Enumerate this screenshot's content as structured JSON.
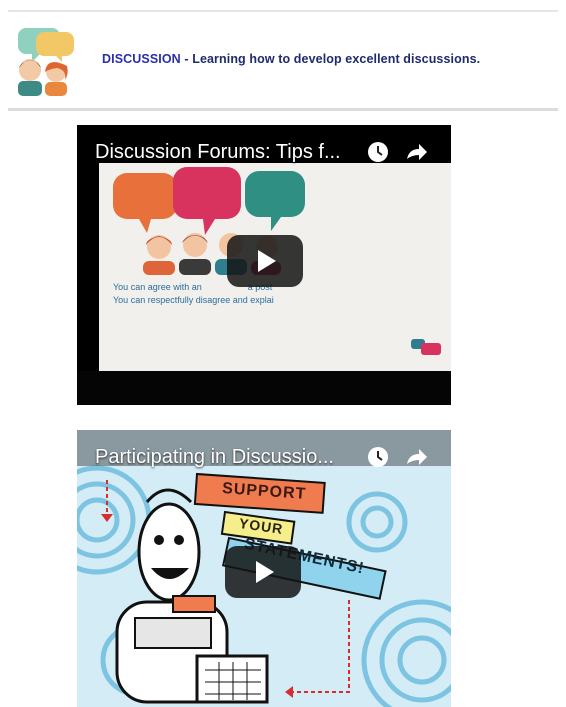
{
  "header": {
    "keyword": "DISCUSSION",
    "rest": " - Learning how to develop excellent discussions."
  },
  "videos": [
    {
      "title": "Discussion Forums: Tips f...",
      "overlay_lines": [
        "You can agree with an",
        "a post",
        "You can respectfully disagree and explai"
      ]
    },
    {
      "title": "Participating in Discussio...",
      "banners": [
        "SUPPORT",
        "YOUR",
        "STATEMENTS!"
      ]
    }
  ],
  "colors": {
    "header_keyword": "#2a2fa8",
    "header_text": "#1f2b6e",
    "bubble_orange": "#e8703a",
    "bubble_pink": "#d8335f",
    "bubble_teal": "#2f8f83",
    "banner_orange": "#ef7b4f",
    "banner_yellow": "#f5ee8a",
    "banner_blue": "#8fd3ec"
  }
}
